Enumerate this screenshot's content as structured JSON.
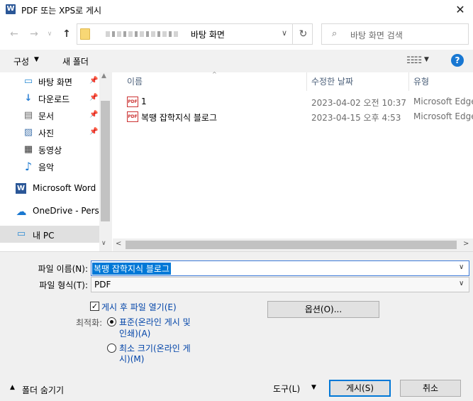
{
  "window": {
    "title": "PDF 또는 XPS로 게시",
    "app_icon_letter": "W",
    "close_glyph": "✕"
  },
  "address": {
    "location": "바탕 화면",
    "search_placeholder": "바탕 화면 검색"
  },
  "toolbar": {
    "organize": "구성",
    "new_folder": "새 폴더"
  },
  "nav": {
    "items": [
      {
        "label": "바탕 화면",
        "icon": "desktop-icon",
        "pinned": true
      },
      {
        "label": "다운로드",
        "icon": "download-icon",
        "pinned": true
      },
      {
        "label": "문서",
        "icon": "document-icon",
        "pinned": true
      },
      {
        "label": "사진",
        "icon": "picture-icon",
        "pinned": true
      },
      {
        "label": "동영상",
        "icon": "video-icon",
        "pinned": false
      },
      {
        "label": "음악",
        "icon": "music-icon",
        "pinned": false
      },
      {
        "label": "Microsoft Word",
        "icon": "word-icon",
        "pinned": false
      },
      {
        "label": "OneDrive - Persor",
        "icon": "cloud-icon",
        "pinned": false
      },
      {
        "label": "내 PC",
        "icon": "pc-icon",
        "pinned": false,
        "selected": true
      }
    ]
  },
  "list": {
    "columns": {
      "name": "이름",
      "modified": "수정한 날짜",
      "type": "유형"
    },
    "rows": [
      {
        "name": "1",
        "modified": "2023-04-02 오전 10:37",
        "type": "Microsoft Edge"
      },
      {
        "name": "복땡 잡학지식 블로그",
        "modified": "2023-04-15 오후 4:53",
        "type": "Microsoft Edge"
      }
    ]
  },
  "form": {
    "file_name_label": "파일 이름(N):",
    "file_name_value": "복땡 잡학지식 블로그",
    "file_type_label": "파일 형식(T):",
    "file_type_value": "PDF",
    "open_after_label": "게시 후 파일 열기(E)",
    "open_after_checked": true,
    "optimize_label": "최적화:",
    "standard_line1": "표준(온라인 게시 및",
    "standard_line2": "인쇄)(A)",
    "minimum_line1": "최소 크기(온라인 게",
    "minimum_line2": "시)(M)",
    "options_button": "옵션(O)...",
    "hide_folders": "폴더 숨기기",
    "tools": "도구(L)",
    "publish": "게시(S)",
    "cancel": "취소"
  },
  "colors": {
    "accent": "#0078d7",
    "link_blue": "#0043a8",
    "help_blue": "#1877d2"
  }
}
